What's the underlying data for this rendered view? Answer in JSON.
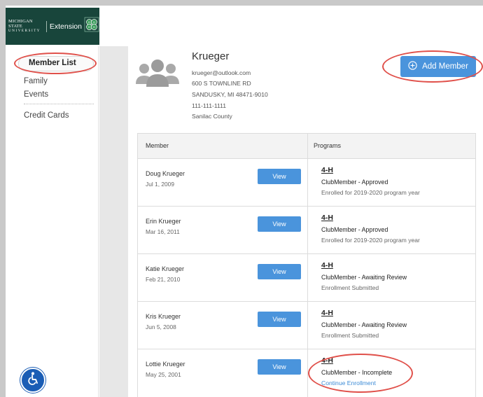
{
  "header": {
    "logo_msu_line1": "MICHIGAN STATE",
    "logo_msu_line2": "U N I V E R S I T Y",
    "logo_extension": "Extension"
  },
  "sidebar": {
    "items": [
      {
        "label": "Member List",
        "active": true
      },
      {
        "label": "Family"
      },
      {
        "label": "Events"
      },
      {
        "label": "Credit Cards"
      }
    ]
  },
  "family": {
    "name": "Krueger",
    "email": "krueger@outlook.com",
    "address1": "600 S TOWNLINE RD",
    "address2": "SANDUSKY, MI 48471-9010",
    "phone": "111-111-1111",
    "county": "Sanilac County"
  },
  "actions": {
    "add_member_label": "Add Member"
  },
  "table": {
    "headers": {
      "member": "Member",
      "programs": "Programs"
    },
    "view_label": "View",
    "rows": [
      {
        "name": "Doug Krueger",
        "date": "Jul 1, 2009",
        "program": "4-H",
        "status": "ClubMember - Approved",
        "note": "Enrolled for 2019-2020 program year"
      },
      {
        "name": "Erin Krueger",
        "date": "Mar 16, 2011",
        "program": "4-H",
        "status": "ClubMember - Approved",
        "note": "Enrolled for 2019-2020 program year"
      },
      {
        "name": "Katie Krueger",
        "date": "Feb 21, 2010",
        "program": "4-H",
        "status": "ClubMember - Awaiting Review",
        "note": "Enrollment Submitted"
      },
      {
        "name": "Kris Krueger",
        "date": "Jun 5, 2008",
        "program": "4-H",
        "status": "ClubMember - Awaiting Review",
        "note": "Enrollment Submitted"
      },
      {
        "name": "Lottie Krueger",
        "date": "May 25, 2001",
        "program": "4-H",
        "status": "ClubMember - Incomplete",
        "note": "Continue Enrollment"
      }
    ]
  },
  "colors": {
    "accent": "#4a94dc",
    "brand": "#18453b",
    "highlight_ring": "#e0504a",
    "accessibility": "#1a5db5"
  }
}
